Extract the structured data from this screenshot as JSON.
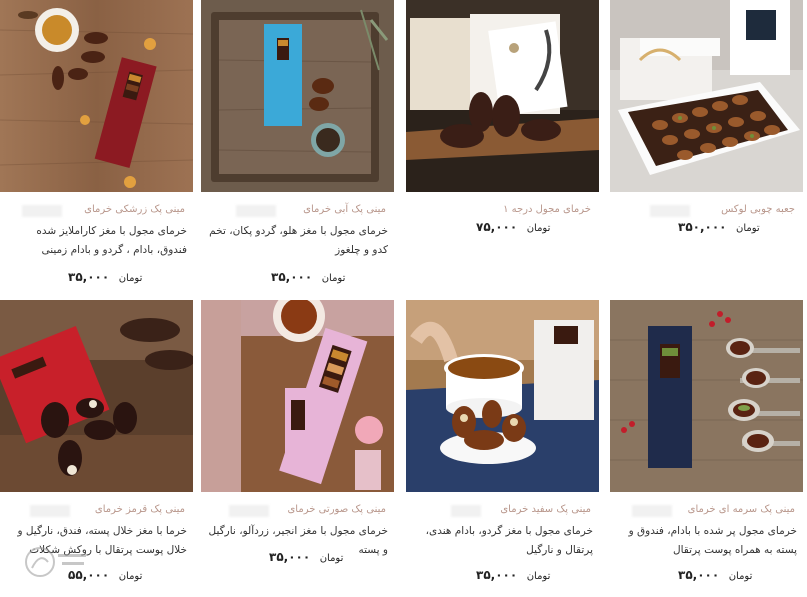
{
  "products": [
    {
      "category": "مینی پک زرشکی خرمای",
      "title": "خرمای مجول با مغز کاراملایز شده فندوق، بادام ، گردو و بادام زمینی",
      "price": "۳۵,۰۰۰",
      "currency": "تومان"
    },
    {
      "category": "مینی پک آبی خرمای",
      "title": "خرمای مجول با مغز هلو، گردو پکان، تخم کدو و چلغوز",
      "price": "۳۵,۰۰۰",
      "currency": "تومان"
    },
    {
      "category": "خرمای مجول درجه ۱",
      "title": "",
      "price": "۷۵,۰۰۰",
      "currency": "تومان"
    },
    {
      "category": "جعبه چوبی لوکس",
      "title": "",
      "price": "۳۵۰,۰۰۰",
      "currency": "تومان"
    },
    {
      "category": "مینی پک قرمز خرمای",
      "title": "خرما با مغز خلال پسته، فندق، نارگیل و خلال پوست پرتقال با روکش شکلات",
      "price": "۵۵,۰۰۰",
      "currency": "تومان"
    },
    {
      "category": "مینی پک صورتی خرمای",
      "title": "خرمای مجول با مغز انجیر، زردآلو، نارگیل و پسته",
      "price": "۳۵,۰۰۰",
      "currency": "تومان"
    },
    {
      "category": "مینی پک سفید خرمای",
      "title": "خرمای مجول با مغز گردو، بادام هندی، پرتقال و نارگیل",
      "price": "۳۵,۰۰۰",
      "currency": "تومان"
    },
    {
      "category": "مینی پک سرمه ای خرمای",
      "title": "خرمای مجول پر شده با بادام، فندوق و پسته به همراه پوست پرتقال",
      "price": "۳۵,۰۰۰",
      "currency": "تومان"
    }
  ],
  "colors": {
    "category": "#b8968b",
    "text": "#333333"
  }
}
